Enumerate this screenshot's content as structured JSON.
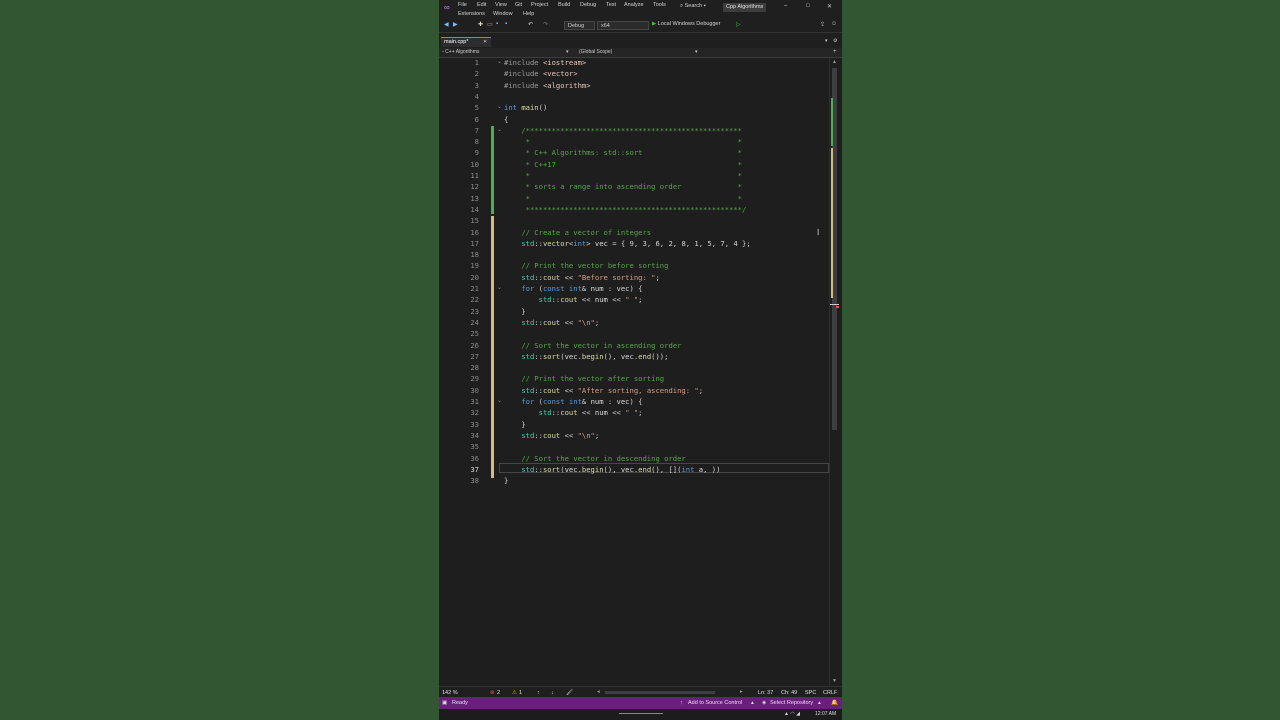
{
  "menu": [
    "File",
    "Edit",
    "View",
    "Git",
    "Project",
    "Build",
    "Debug",
    "Test",
    "Analyze",
    "Tools",
    "Extensions",
    "Window",
    "Help"
  ],
  "search": "Search",
  "solution_name": "Cpp Algorithms",
  "toolbar": {
    "config": "Debug",
    "platform": "x64",
    "debugger": "Local Windows Debugger"
  },
  "tab": {
    "name": "main.cpp*",
    "close": "✕"
  },
  "nav": {
    "project": "C++ Algorithms",
    "scope": "(Global Scope)"
  },
  "code_lines": [
    "#include <iostream>",
    "#include <vector>",
    "#include <algorithm>",
    "",
    "int main()",
    "{",
    "    /**************************************************",
    "     *                                                *",
    "     * C++ Algorithms: std::sort                      *",
    "     * C++17                                          *",
    "     *                                                *",
    "     * sorts a range into ascending order             *",
    "     *                                                *",
    "     **************************************************/",
    "",
    "    // Create a vector of integers",
    "    std::vector<int> vec = { 9, 3, 6, 2, 8, 1, 5, 7, 4 };",
    "",
    "    // Print the vector before sorting",
    "    std::cout << \"Before sorting: \";",
    "    for (const int& num : vec) {",
    "        std::cout << num << \" \";",
    "    }",
    "    std::cout << \"\\n\";",
    "",
    "    // Sort the vector in ascending order",
    "    std::sort(vec.begin(), vec.end());",
    "",
    "    // Print the vector after sorting",
    "    std::cout << \"After sorting, ascending: \";",
    "    for (const int& num : vec) {",
    "        std::cout << num << \" \";",
    "    }",
    "    std::cout << \"\\n\";",
    "",
    "    // Sort the vector in descending order",
    "    std::sort(vec.begin(), vec.end(), [](int a, ))",
    "}"
  ],
  "current_line": 37,
  "status_bar": {
    "zoom": "142 %",
    "errors": "2",
    "warnings": "1",
    "line": "Ln: 37",
    "col": "Ch: 49",
    "spc": "SPC",
    "crlf": "CRLF",
    "ready": "Ready",
    "source_control": "Add to Source Control",
    "repo": "Select Repository",
    "time": "12:07 AM"
  },
  "colors": {
    "accent": "#68217a",
    "status_bar": "#68217a",
    "bg": "#1f1f1f",
    "outer_bg": "#325532"
  }
}
